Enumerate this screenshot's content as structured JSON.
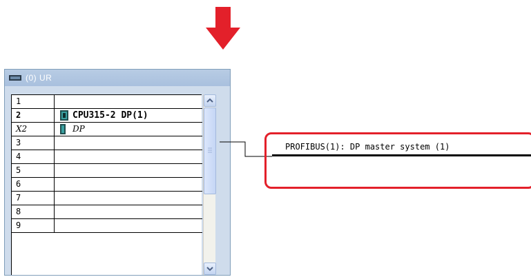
{
  "rack": {
    "title": "(0)  UR",
    "rows": [
      {
        "slot": "1",
        "module": ""
      },
      {
        "slot": "2",
        "module": "CPU315-2 DP(1)"
      },
      {
        "slot": "X2",
        "module": "DP"
      },
      {
        "slot": "3",
        "module": ""
      },
      {
        "slot": "4",
        "module": ""
      },
      {
        "slot": "5",
        "module": ""
      },
      {
        "slot": "6",
        "module": ""
      },
      {
        "slot": "7",
        "module": ""
      },
      {
        "slot": "8",
        "module": ""
      },
      {
        "slot": "9",
        "module": ""
      }
    ]
  },
  "profibus": {
    "label": "PROFIBUS(1): DP master system (1)"
  },
  "colors": {
    "arrow": "#e3202a",
    "highlight": "#e3202a",
    "rack_bg": "#cfdcec"
  }
}
